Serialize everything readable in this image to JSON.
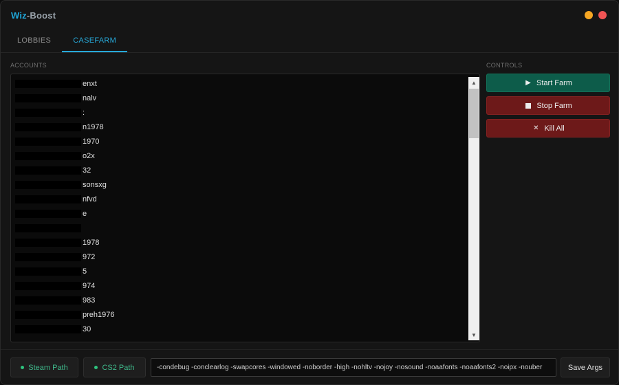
{
  "app": {
    "title_part1": "Wiz",
    "title_part2": "-Boost",
    "minimize_color": "#f5a623",
    "close_color": "#f05454"
  },
  "tabs": [
    {
      "label": "LOBBIES",
      "active": false
    },
    {
      "label": "CASEFARM",
      "active": true
    }
  ],
  "accounts": {
    "section_label": "ACCOUNTS",
    "items": [
      "enxt",
      "nalv",
      ":",
      "n1978",
      "1970",
      "o2x",
      "32",
      "sonsxg",
      "nfvd",
      "e",
      "",
      "1978",
      "972",
      "5",
      "974",
      "983",
      "preh1976",
      "30"
    ]
  },
  "controls": {
    "section_label": "CONTROLS",
    "start": {
      "label": "Start Farm",
      "icon": "play-icon"
    },
    "stop": {
      "label": "Stop Farm",
      "icon": "stop-icon"
    },
    "kill": {
      "label": "Kill All",
      "icon": "close-icon"
    }
  },
  "bottom": {
    "steam_path_label": "Steam Path",
    "cs2_path_label": "CS2 Path",
    "args_value": "-condebug -conclearlog -swapcores -windowed -noborder -high -nohltv -nojoy -nosound -noaafonts -noaafonts2 -noipx -nouber",
    "save_label": "Save Args"
  },
  "colors": {
    "accent": "#27a9d9",
    "start_button": "#0d5c4a",
    "stop_button": "#6d1919",
    "path_indicator": "#2ec27e"
  }
}
